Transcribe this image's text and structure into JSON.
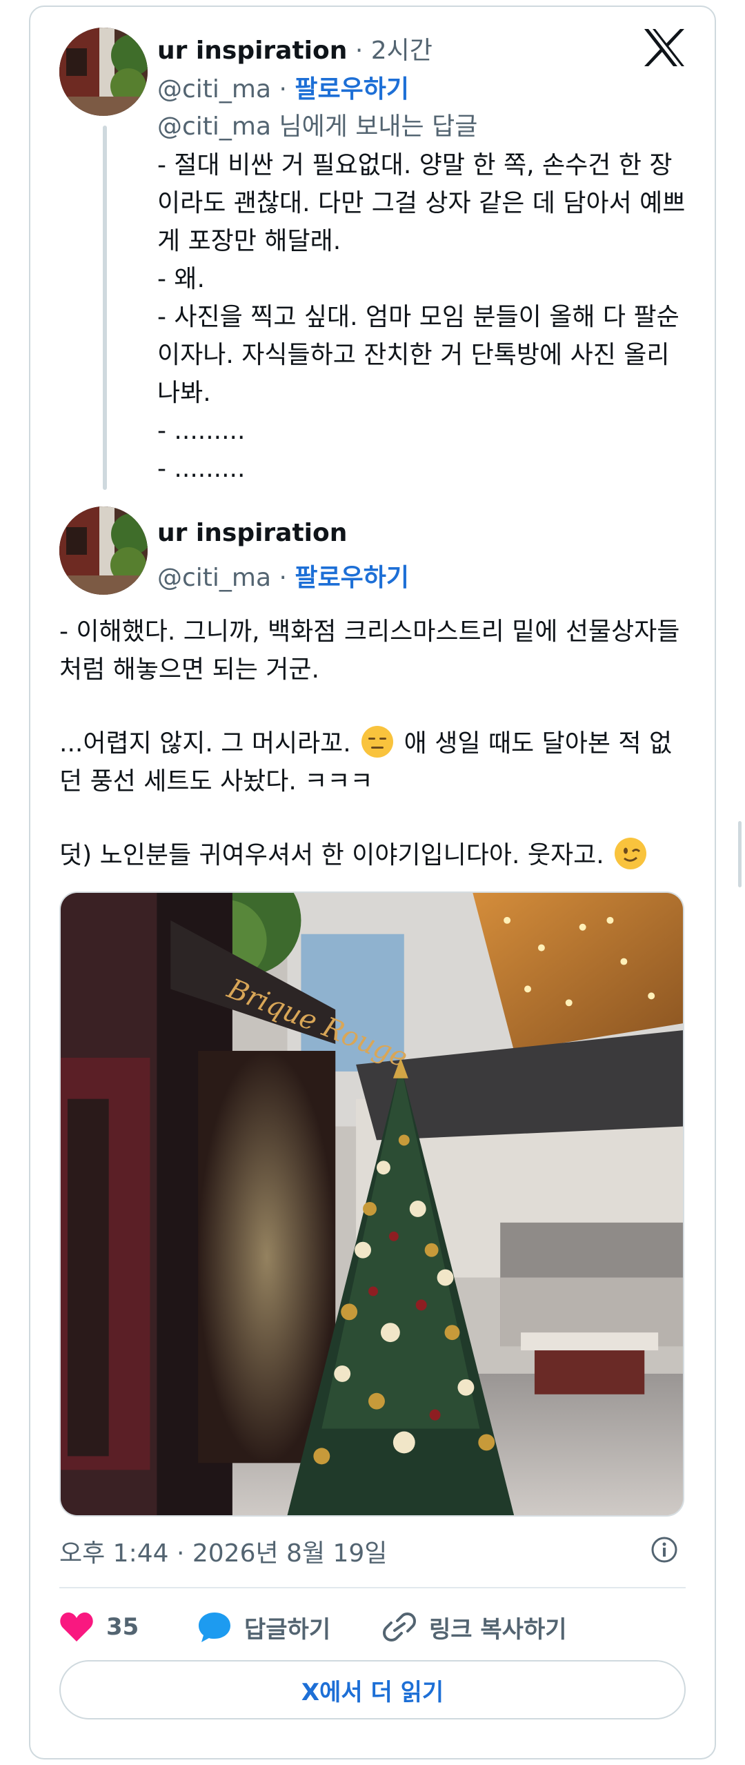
{
  "reply_tweet": {
    "author_name": "ur inspiration",
    "time_ago": "2시간",
    "handle": "@citi_ma",
    "follow_label": "팔로우하기",
    "reply_to": "@citi_ma 님에게 보내는 답글",
    "lines": [
      "- 절대 비싼 거 필요없대. 양말 한 쪽, 손수건 한 장",
      "이라도 괜찮대. 다만 그걸 상자 같은 데 담아서 예쁘",
      "게 포장만 해달래.",
      "- 왜.",
      "- 사진을 찍고 싶대. 엄마 모임 분들이 올해 다 팔순",
      "이자나. 자식들하고 잔치한 거 단톡방에 사진 올리",
      "나봐.",
      "- .........",
      "- ........."
    ]
  },
  "main_tweet": {
    "author_name": "ur inspiration",
    "handle": "@citi_ma",
    "follow_label": "팔로우하기",
    "para1_line1": "- 이해했다. 그니까, 백화점 크리스마스트리 밑에 선물상자들",
    "para1_line2": "처럼 해놓으면 되는 거군.",
    "para2_line1_a": "...어렵지 않지. 그 머시라꼬.",
    "para2_line1_b": "애 생일 때도 달아본 적 없",
    "para2_line2": "던 풍선 세트도 사놨다. ㅋㅋㅋ",
    "para3": "덧) 노인분들 귀여우셔서 한 이야기입니다아. 웃자고.",
    "photo_sign_text": "Brique Rouge",
    "timestamp": "오후 1:44 · 2026년 8월 19일"
  },
  "actions": {
    "like_count": "35",
    "reply_label": "답글하기",
    "copy_link_label": "링크 복사하기",
    "read_more_label": "X에서 더 읽기"
  },
  "colors": {
    "accent": "#1d6fd6",
    "like": "#f91880",
    "reply_icon": "#1d9bf0",
    "secondary_text": "#536471",
    "border": "#cfd9de"
  },
  "icons": [
    "x-logo-icon",
    "heart-icon",
    "speech-bubble-icon",
    "link-icon",
    "info-icon",
    "expressionless-face-emoji",
    "winking-face-emoji"
  ]
}
